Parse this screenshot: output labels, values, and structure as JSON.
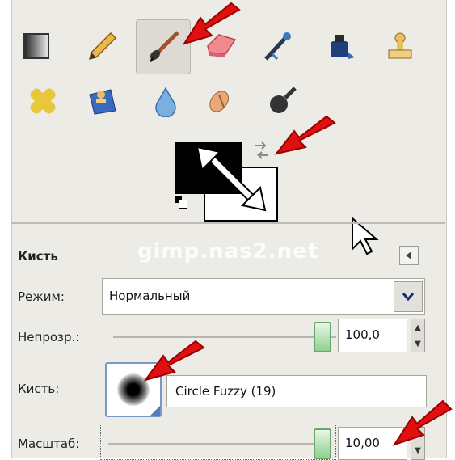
{
  "toolbox": {
    "row1": [
      "blend-icon",
      "pencil-icon",
      "paintbrush-icon",
      "eraser-icon",
      "airbrush-icon",
      "ink-icon",
      "clone-icon"
    ],
    "row2": [
      "heal-icon",
      "perspective-clone-icon",
      "blur-icon",
      "smudge-icon",
      "dodge-burn-icon"
    ]
  },
  "colors": {
    "foreground": "#000000",
    "background": "#ffffff",
    "accent_red": "#e01010"
  },
  "watermark": "gimp.nas2.net",
  "options": {
    "title": "Кисть",
    "mode_label": "Режим:",
    "mode_value": "Нормальный",
    "opacity_label": "Непрозр.:",
    "opacity_value": "100,0",
    "brush_label": "Кисть:",
    "brush_name": "Circle Fuzzy (19)",
    "scale_label": "Масштаб:",
    "scale_value": "10,00"
  }
}
